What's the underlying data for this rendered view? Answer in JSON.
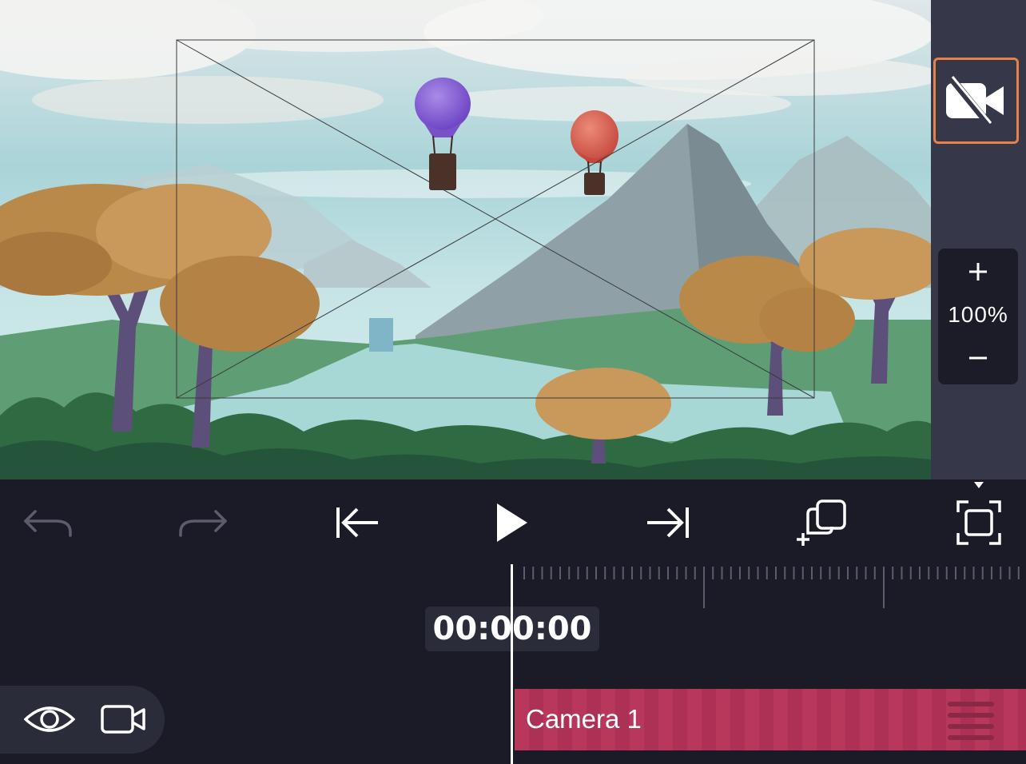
{
  "canvas": {
    "scene": "watercolor landscape with two hot air balloons, mountains, trees and a river",
    "camera_frame": "camera viewport frame"
  },
  "sidebar": {
    "camera_toggle_icon": "video-off-icon",
    "zoom": {
      "plus_icon": "plus-icon",
      "level": "100%",
      "minus_icon": "minus-icon"
    }
  },
  "toolbar": {
    "undo_icon": "undo-icon",
    "redo_icon": "redo-icon",
    "jump_start_icon": "jump-to-start-icon",
    "play_icon": "play-icon",
    "jump_end_icon": "jump-to-end-icon",
    "add_layer_icon": "add-copy-icon",
    "fit_icon": "fit-frame-icon"
  },
  "timeline": {
    "timecode": "00:00:00",
    "layer_controls": {
      "visibility_icon": "eye-icon",
      "camera_icon": "camera-icon"
    },
    "tracks": [
      {
        "label": "Camera 1",
        "handle_icon": "drag-handle-icon"
      }
    ]
  },
  "colors": {
    "background": "#1a1b26",
    "sidebar": "#363748",
    "accent_orange": "#e8804a",
    "track_red": "#b8385c"
  }
}
